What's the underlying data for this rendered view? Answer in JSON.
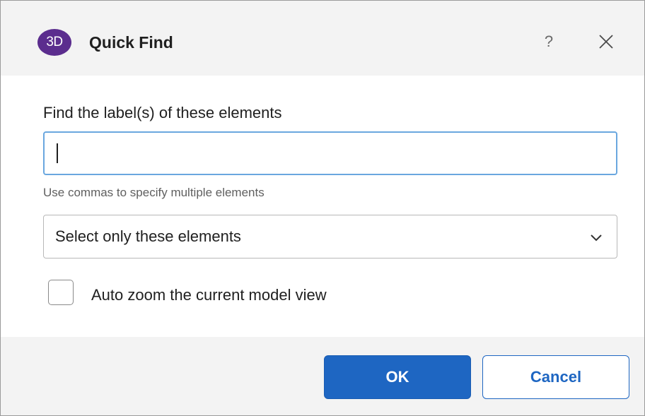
{
  "dialog": {
    "title": "Quick Find",
    "logo_text": "3D",
    "help_label": "?",
    "icons": {
      "logo": "app-logo-3d",
      "help": "question-mark-icon",
      "close": "close-icon",
      "dropdown": "chevron-down-icon"
    },
    "colors": {
      "logo_bg": "#5b2d8e",
      "accent": "#1e66c2",
      "input_focus_border": "#6aa7df",
      "panel_bg": "#f3f3f3"
    }
  },
  "form": {
    "find_label": "Find the label(s) of these elements",
    "find_value": "",
    "hint": "Use commas to specify multiple elements",
    "selection_mode": "Select only these elements",
    "auto_zoom_label": "Auto zoom the current model view",
    "auto_zoom_checked": false
  },
  "buttons": {
    "ok": "OK",
    "cancel": "Cancel"
  }
}
